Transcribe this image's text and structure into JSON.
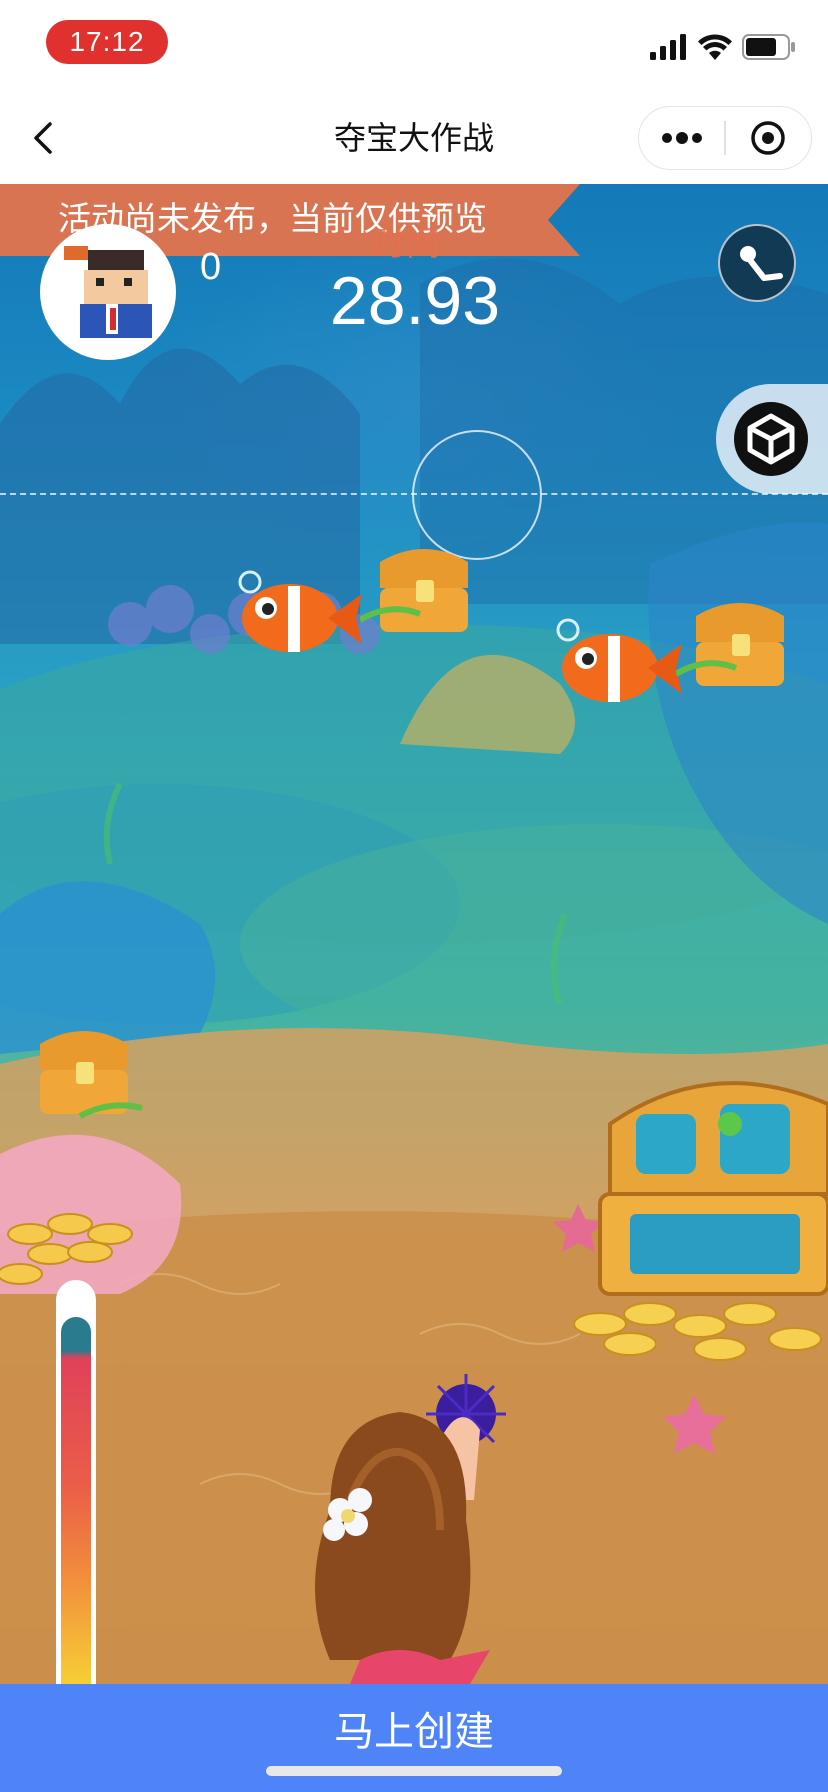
{
  "status_bar": {
    "time": "17:12"
  },
  "nav": {
    "title": "夺宝大作战"
  },
  "game": {
    "preview_banner": "活动尚未发布，当前仅供预览",
    "score": "0",
    "time_label": "时间",
    "timer": "28.93",
    "power_level": 0.92
  },
  "bottom_button": {
    "label": "马上创建"
  },
  "colors": {
    "accent": "#4f84f8",
    "banner": "#e3744b",
    "time_pill": "#e0312f"
  },
  "icons": [
    "chevron-left-icon",
    "more-dots-icon",
    "target-circle-icon",
    "fishing-pole-icon",
    "unity-logo-icon"
  ]
}
